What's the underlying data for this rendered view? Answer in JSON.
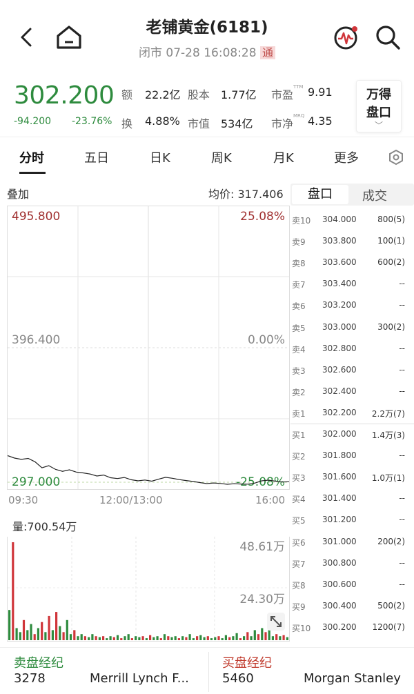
{
  "header": {
    "title": "老铺黄金(6181)",
    "status": "闭市 07-28 16:08:28",
    "badge": "通"
  },
  "quote": {
    "price": "302.200",
    "change": "-94.200",
    "change_pct": "-23.76%",
    "stats": [
      {
        "label": "额",
        "value": "22.2亿"
      },
      {
        "label": "股本",
        "value": "1.77亿"
      },
      {
        "label": "市盈",
        "sup": "TTM",
        "value": "9.91"
      },
      {
        "label": "换",
        "value": "4.88%"
      },
      {
        "label": "市值",
        "value": "534亿"
      },
      {
        "label": "市净",
        "sup": "MRQ",
        "value": "4.35"
      }
    ],
    "wind_label_1": "万得",
    "wind_label_2": "盘口"
  },
  "tabs": [
    "分时",
    "五日",
    "日K",
    "周K",
    "月K",
    "更多"
  ],
  "chart": {
    "overlay_label": "叠加",
    "avg_label": "均价: 317.406",
    "y_top": "495.800",
    "y_mid": "396.400",
    "y_bot": "297.000",
    "pct_top": "25.08%",
    "pct_mid": "0.00%",
    "pct_bot": "-25.08%",
    "time_start": "09:30",
    "time_mid": "12:00/13:00",
    "time_end": "16:00",
    "vol_label": "量:700.54万",
    "vol_top": "48.61万",
    "vol_mid": "24.30万",
    "colors": {
      "up": "#d0353a",
      "down": "#2e8b3e",
      "line": "#222222"
    }
  },
  "chart_data": {
    "type": "line",
    "title": "",
    "xlabel": "",
    "ylabel": "",
    "ylim": [
      297.0,
      495.8
    ],
    "x_ticks": [
      "09:30",
      "12:00/13:00",
      "16:00"
    ],
    "series": [
      {
        "values": [
          320.5,
          318.8,
          317.9,
          318.6,
          316.2,
          312.0,
          313.5,
          310.8,
          309.5,
          310.6,
          309.0,
          308.4,
          307.6,
          306.2,
          306.9,
          305.0,
          304.4,
          305.2,
          303.6,
          302.8,
          303.4,
          302.6,
          304.0,
          305.3,
          304.6,
          303.7,
          303.0,
          302.4,
          301.6,
          300.9,
          301.3,
          301.0,
          300.4,
          300.8,
          300.6,
          300.5,
          301.2,
          302.8,
          303.3,
          302.6,
          302.0,
          302.2
        ]
      }
    ]
  },
  "volume_data": [
    {
      "v": 15,
      "d": 1
    },
    {
      "v": 48.6,
      "d": 0
    },
    {
      "v": 6,
      "d": 1
    },
    {
      "v": 4,
      "d": 1
    },
    {
      "v": 10,
      "d": 0
    },
    {
      "v": 5,
      "d": 1
    },
    {
      "v": 8,
      "d": 1
    },
    {
      "v": 3,
      "d": 0
    },
    {
      "v": 6,
      "d": 1
    },
    {
      "v": 9,
      "d": 0
    },
    {
      "v": 4,
      "d": 1
    },
    {
      "v": 12,
      "d": 0
    },
    {
      "v": 5,
      "d": 1
    },
    {
      "v": 14,
      "d": 0
    },
    {
      "v": 7,
      "d": 1
    },
    {
      "v": 4,
      "d": 0
    },
    {
      "v": 10,
      "d": 1
    },
    {
      "v": 3,
      "d": 1
    },
    {
      "v": 5,
      "d": 0
    },
    {
      "v": 2,
      "d": 1
    },
    {
      "v": 3,
      "d": 1
    },
    {
      "v": 2,
      "d": 0
    },
    {
      "v": 1.5,
      "d": 1
    },
    {
      "v": 3,
      "d": 1
    },
    {
      "v": 2,
      "d": 0
    },
    {
      "v": 1.5,
      "d": 1
    },
    {
      "v": 2,
      "d": 0
    },
    {
      "v": 1,
      "d": 1
    },
    {
      "v": 2,
      "d": 1
    },
    {
      "v": 1.5,
      "d": 0
    },
    {
      "v": 2.5,
      "d": 1
    },
    {
      "v": 1,
      "d": 0
    },
    {
      "v": 2,
      "d": 1
    },
    {
      "v": 3,
      "d": 1
    },
    {
      "v": 1,
      "d": 0
    },
    {
      "v": 2,
      "d": 1
    },
    {
      "v": 1.5,
      "d": 1
    },
    {
      "v": 2,
      "d": 0
    },
    {
      "v": 1,
      "d": 1
    },
    {
      "v": 2.5,
      "d": 0
    },
    {
      "v": 1.5,
      "d": 1
    },
    {
      "v": 2,
      "d": 1
    },
    {
      "v": 1,
      "d": 0
    },
    {
      "v": 3,
      "d": 1
    },
    {
      "v": 2,
      "d": 0
    },
    {
      "v": 1.5,
      "d": 1
    },
    {
      "v": 2,
      "d": 1
    },
    {
      "v": 1,
      "d": 0
    },
    {
      "v": 2,
      "d": 1
    },
    {
      "v": 1.5,
      "d": 0
    },
    {
      "v": 3,
      "d": 1
    },
    {
      "v": 1,
      "d": 1
    },
    {
      "v": 2,
      "d": 0
    },
    {
      "v": 2.5,
      "d": 1
    },
    {
      "v": 1.5,
      "d": 1
    },
    {
      "v": 2,
      "d": 0
    },
    {
      "v": 1,
      "d": 1
    },
    {
      "v": 1.5,
      "d": 1
    },
    {
      "v": 2,
      "d": 0
    },
    {
      "v": 1,
      "d": 1
    },
    {
      "v": 2.5,
      "d": 1
    },
    {
      "v": 1.5,
      "d": 0
    },
    {
      "v": 2,
      "d": 1
    },
    {
      "v": 3.5,
      "d": 1
    },
    {
      "v": 1,
      "d": 0
    },
    {
      "v": 2,
      "d": 1
    },
    {
      "v": 4,
      "d": 0
    },
    {
      "v": 2,
      "d": 1
    },
    {
      "v": 5,
      "d": 1
    },
    {
      "v": 3,
      "d": 0
    },
    {
      "v": 6,
      "d": 1
    },
    {
      "v": 4,
      "d": 0
    },
    {
      "v": 5.5,
      "d": 1
    },
    {
      "v": 2,
      "d": 1
    },
    {
      "v": 3,
      "d": 0
    },
    {
      "v": 2,
      "d": 1
    },
    {
      "v": 2.5,
      "d": 0
    },
    {
      "v": 1.5,
      "d": 1
    }
  ],
  "orderbook": {
    "tab_active": "盘口",
    "tab_other": "成交",
    "asks": [
      {
        "label": "卖10",
        "price": "304.000",
        "qty": "800(5)"
      },
      {
        "label": "卖9",
        "price": "303.800",
        "qty": "100(1)"
      },
      {
        "label": "卖8",
        "price": "303.600",
        "qty": "600(2)"
      },
      {
        "label": "卖7",
        "price": "303.400",
        "qty": "--"
      },
      {
        "label": "卖6",
        "price": "303.200",
        "qty": "--"
      },
      {
        "label": "卖5",
        "price": "303.000",
        "qty": "300(2)"
      },
      {
        "label": "卖4",
        "price": "302.800",
        "qty": "--"
      },
      {
        "label": "卖3",
        "price": "302.600",
        "qty": "--"
      },
      {
        "label": "卖2",
        "price": "302.400",
        "qty": "--"
      },
      {
        "label": "卖1",
        "price": "302.200",
        "qty": "2.2万(7)"
      }
    ],
    "bids": [
      {
        "label": "买1",
        "price": "302.000",
        "qty": "1.4万(3)"
      },
      {
        "label": "买2",
        "price": "301.800",
        "qty": "--"
      },
      {
        "label": "买3",
        "price": "301.600",
        "qty": "1.0万(1)"
      },
      {
        "label": "买4",
        "price": "301.400",
        "qty": "--"
      },
      {
        "label": "买5",
        "price": "301.200",
        "qty": "--"
      },
      {
        "label": "买6",
        "price": "301.000",
        "qty": "200(2)"
      },
      {
        "label": "买7",
        "price": "300.800",
        "qty": "--"
      },
      {
        "label": "买8",
        "price": "300.600",
        "qty": "--"
      },
      {
        "label": "买9",
        "price": "300.400",
        "qty": "500(2)"
      },
      {
        "label": "买10",
        "price": "300.200",
        "qty": "1200(7)"
      }
    ]
  },
  "brokers": {
    "sell_title": "卖盘经纪",
    "sell_code": "3278",
    "sell_name": "Merrill Lynch F...",
    "buy_title": "买盘经纪",
    "buy_code": "5460",
    "buy_name": "Morgan Stanley"
  }
}
